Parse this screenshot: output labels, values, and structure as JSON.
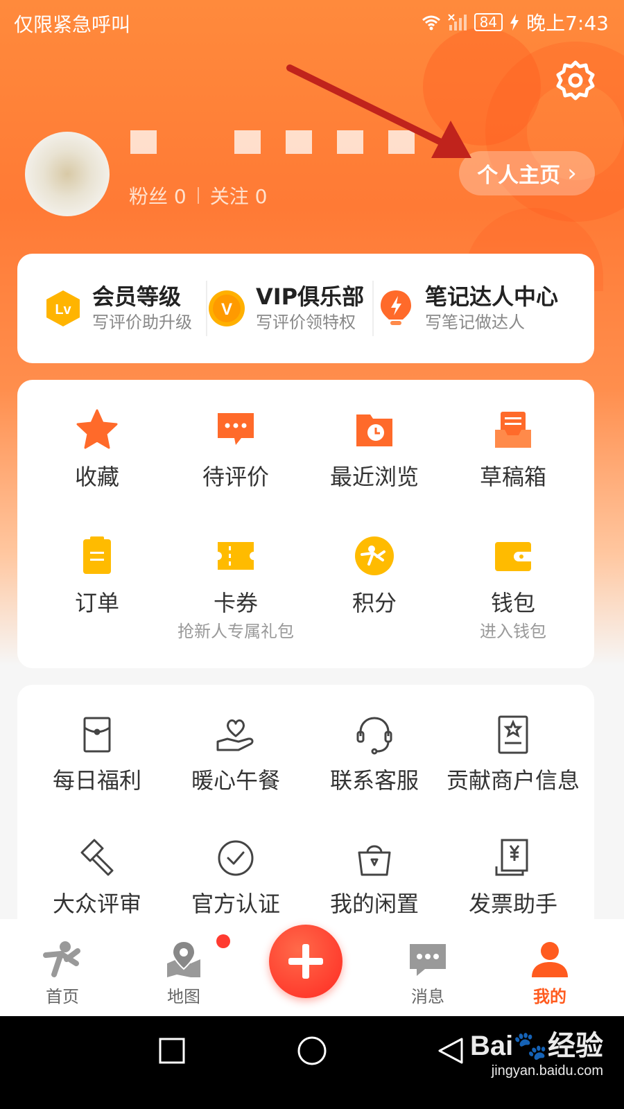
{
  "status_bar": {
    "carrier": "仅限紧急呼叫",
    "battery": "84",
    "time": "晚上7:43"
  },
  "profile": {
    "stats": {
      "fans_label": "粉丝 0",
      "following_label": "关注 0"
    },
    "homepage_button": "个人主页",
    "homepage_chevron": "›"
  },
  "member": [
    {
      "title": "会员等级",
      "subtitle": "写评价助升级",
      "icon": "lv-badge-icon",
      "color": "#ffb400"
    },
    {
      "title": "VIP俱乐部",
      "subtitle": "写评价领特权",
      "icon": "vip-badge-icon",
      "color": "#ff9a00"
    },
    {
      "title": "笔记达人中心",
      "subtitle": "写笔记做达人",
      "icon": "bulb-badge-icon",
      "color": "#ff6a2a"
    }
  ],
  "grid": [
    {
      "label": "收藏",
      "sub": "",
      "icon": "star-icon"
    },
    {
      "label": "待评价",
      "sub": "",
      "icon": "comment-icon"
    },
    {
      "label": "最近浏览",
      "sub": "",
      "icon": "history-folder-icon"
    },
    {
      "label": "草稿箱",
      "sub": "",
      "icon": "draft-box-icon"
    },
    {
      "label": "订单",
      "sub": "",
      "icon": "order-icon"
    },
    {
      "label": "卡券",
      "sub": "抢新人专属礼包",
      "icon": "coupon-icon"
    },
    {
      "label": "积分",
      "sub": "",
      "icon": "points-icon"
    },
    {
      "label": "钱包",
      "sub": "进入钱包",
      "icon": "wallet-icon"
    }
  ],
  "tools": [
    {
      "label": "每日福利",
      "icon": "red-envelope-icon"
    },
    {
      "label": "暖心午餐",
      "icon": "heart-hand-icon"
    },
    {
      "label": "联系客服",
      "icon": "headset-icon"
    },
    {
      "label": "贡献商户信息",
      "icon": "store-info-icon"
    },
    {
      "label": "大众评审",
      "icon": "gavel-icon"
    },
    {
      "label": "官方认证",
      "icon": "check-circle-icon"
    },
    {
      "label": "我的闲置",
      "icon": "bag-icon"
    },
    {
      "label": "发票助手",
      "icon": "invoice-icon"
    }
  ],
  "tabbar": {
    "tabs": [
      {
        "label": "首页",
        "icon": "home-person-icon"
      },
      {
        "label": "地图",
        "icon": "map-pin-icon"
      },
      {
        "label": "消息",
        "icon": "message-icon"
      },
      {
        "label": "我的",
        "icon": "user-icon"
      }
    ],
    "active": "我的",
    "accent": "#ff5b1f"
  },
  "watermark": {
    "brand": "Bai",
    "brand_suffix": "经验",
    "url": "jingyan.baidu.com"
  },
  "theme": {
    "primary": "#ff7a35",
    "plus_button": "#ff3b2a"
  }
}
